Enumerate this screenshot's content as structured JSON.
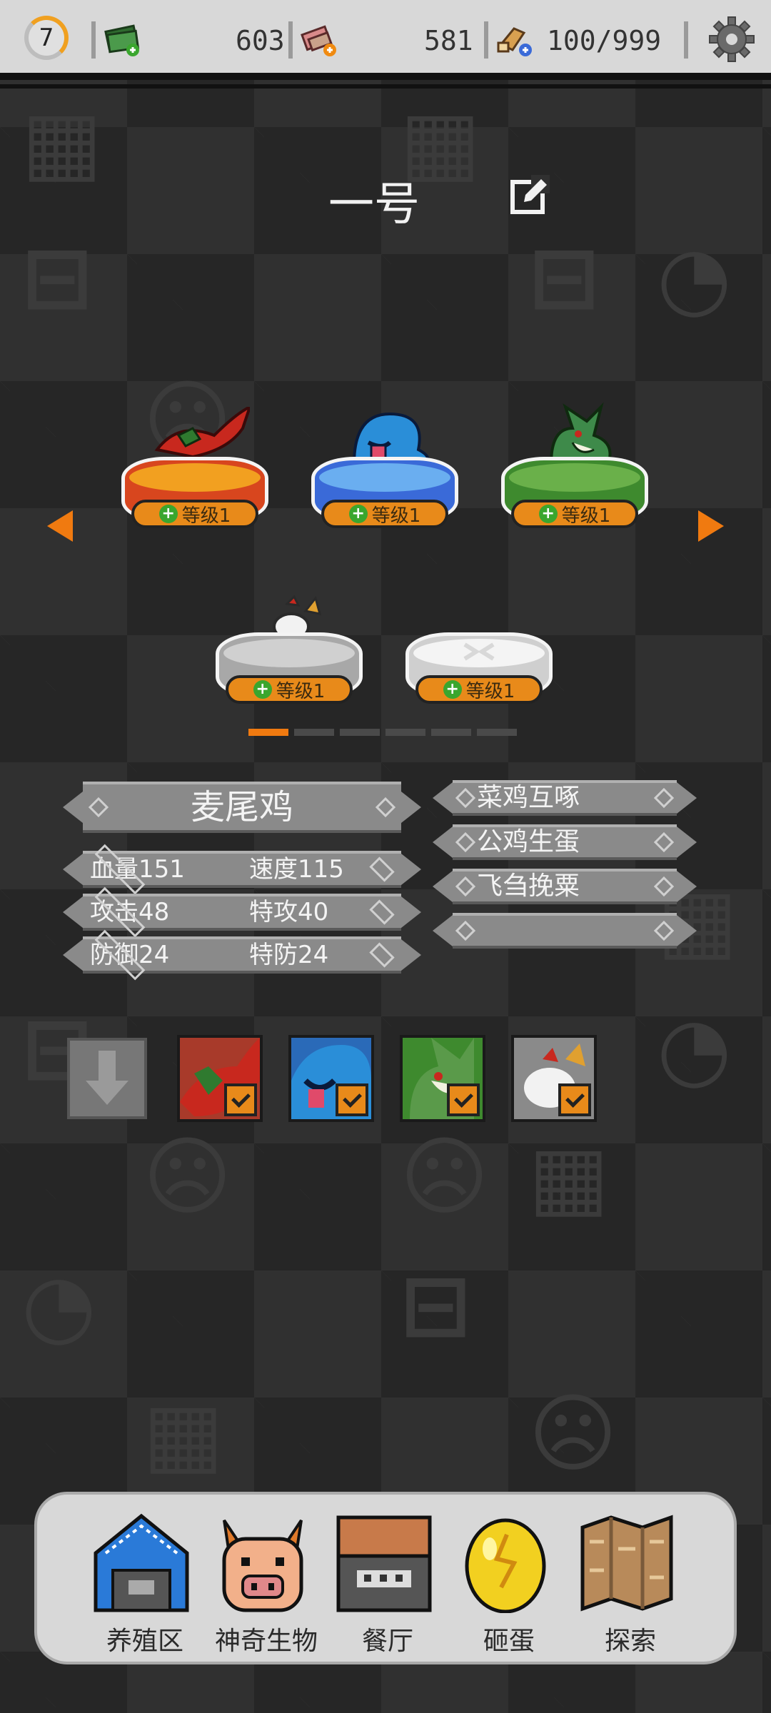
{
  "header": {
    "level": "7",
    "resources": [
      {
        "icon": "cash-icon",
        "value": "603"
      },
      {
        "icon": "eraser-icon",
        "value": "581"
      },
      {
        "icon": "food-icon",
        "value": "100/999"
      }
    ]
  },
  "team": {
    "name": "一号",
    "pets": [
      {
        "name": "fire-pedestal-pet",
        "level_label": "等级1"
      },
      {
        "name": "water-pedestal-pet",
        "level_label": "等级1"
      },
      {
        "name": "grass-pedestal-pet",
        "level_label": "等级1"
      },
      {
        "name": "normal-pedestal-pet",
        "level_label": "等级1"
      },
      {
        "name": "empty-pedestal",
        "level_label": "等级1"
      }
    ],
    "page_count": 6,
    "active_page": 1
  },
  "creature": {
    "name": "麦尾鸡",
    "stats": [
      [
        "血量151",
        "速度115"
      ],
      [
        "攻击48",
        "特攻40"
      ],
      [
        "防御24",
        "特防24"
      ]
    ],
    "skills": [
      "菜鸡互啄",
      "公鸡生蛋",
      "飞刍挽粟",
      ""
    ]
  },
  "bottom_nav": [
    {
      "label": "养殖区",
      "icon": "barn-icon"
    },
    {
      "label": "神奇生物",
      "icon": "pig-monster-icon"
    },
    {
      "label": "餐厅",
      "icon": "restaurant-icon"
    },
    {
      "label": "砸蛋",
      "icon": "golden-egg-icon"
    },
    {
      "label": "探索",
      "icon": "map-icon"
    }
  ],
  "colors": {
    "accent": "#f07a10",
    "topbar": "#d8d8d8",
    "plate": "#8a8a8a"
  }
}
